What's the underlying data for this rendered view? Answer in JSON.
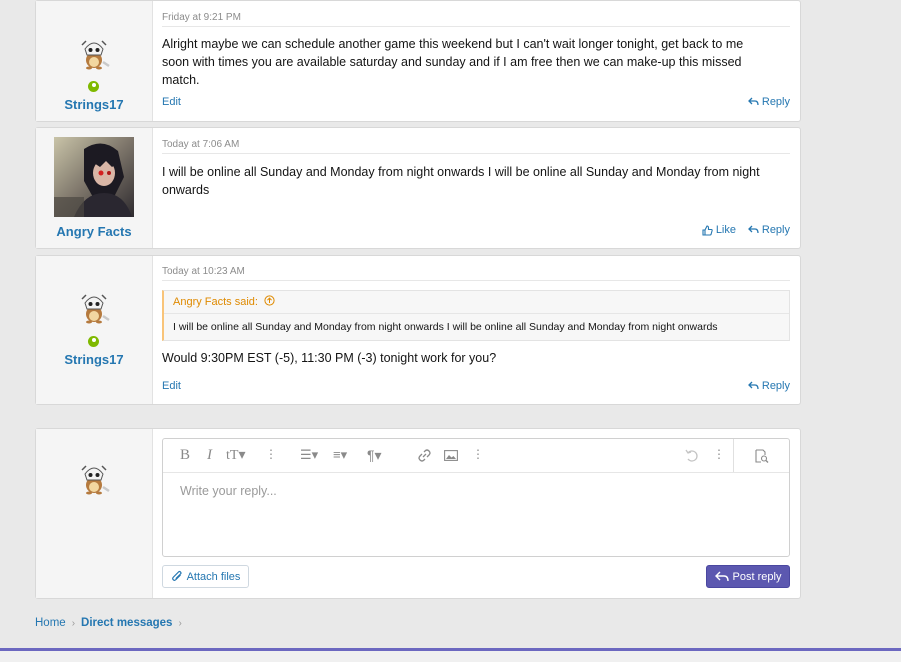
{
  "messages": [
    {
      "user": "Strings17",
      "timestamp": "Friday at 9:21 PM",
      "text": "Alright maybe we can schedule another game this weekend but I can't wait longer tonight, get back to me soon with times you are available saturday and sunday and if I am free then we can make-up this missed match.",
      "actions": {
        "edit": "Edit",
        "reply": "Reply"
      }
    },
    {
      "user": "Angry Facts",
      "timestamp": "Today at 7:06 AM",
      "text": "I will be online all Sunday and Monday from night onwards I will be online all Sunday and Monday from night onwards",
      "actions": {
        "like": "Like",
        "reply": "Reply"
      }
    },
    {
      "user": "Strings17",
      "timestamp": "Today at 10:23 AM",
      "quote": {
        "author": "Angry Facts said:",
        "text": "I will be online all Sunday and Monday from night onwards I will be online all Sunday and Monday from night onwards"
      },
      "text": "Would 9:30PM EST (-5), 11:30 PM (-3) tonight work for you?",
      "actions": {
        "edit": "Edit",
        "reply": "Reply"
      }
    }
  ],
  "reply_box": {
    "placeholder": "Write your reply...",
    "attach_label": "Attach files",
    "post_label": "Post reply"
  },
  "breadcrumb": {
    "home": "Home",
    "current": "Direct messages"
  },
  "colors": {
    "link": "#2577b1",
    "accent": "#5c58b0",
    "online": "#7fb900",
    "quote_author": "#df8a00"
  }
}
